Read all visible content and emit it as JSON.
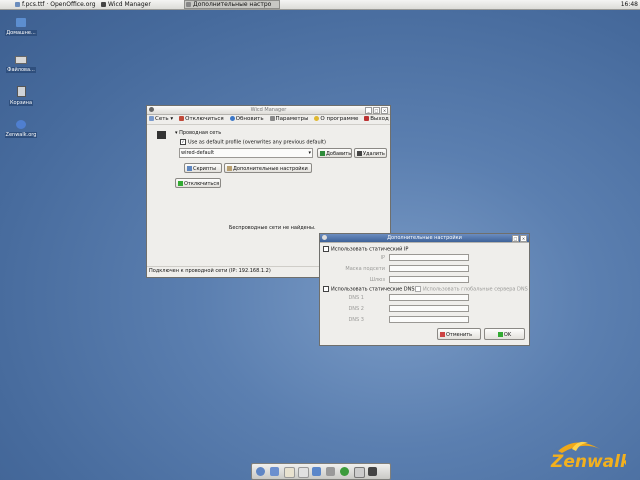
{
  "taskbar": {
    "tasks": [
      {
        "label": "f.pcs.ttf · OpenOffice.org"
      },
      {
        "label": "Wicd Manager"
      },
      {
        "label": "Дополнительные настро"
      }
    ],
    "clock": "16:48"
  },
  "desktop": {
    "icons": [
      {
        "label": "Домашне...",
        "icon": "home-folder-icon"
      },
      {
        "label": "Файлова...",
        "icon": "drive-icon"
      },
      {
        "label": "Корзина",
        "icon": "trash-icon"
      },
      {
        "label": "Zenwalk.org",
        "icon": "link-icon"
      }
    ]
  },
  "wicd": {
    "title": "Wicd Manager",
    "toolbar": {
      "network": "Сеть",
      "disconnect": "Отключиться",
      "refresh": "Обновить",
      "preferences": "Параметры",
      "about": "О программе",
      "quit": "Выход"
    },
    "wired_header": "Проводная сеть",
    "default_profile_label": "Use as default profile (overwrites any previous default)",
    "profile_value": "wired-default",
    "add_label": "Добавить",
    "delete_label": "Удалить",
    "scripts_label": "Скрипты",
    "advanced_label": "Дополнительные настройки",
    "disconnect_label": "Отключиться",
    "no_wireless": "Беспроводные сети не найдены.",
    "status": "Подключен к проводной сети (IP: 192.168.1.2)"
  },
  "advanced": {
    "title": "Дополнительные настройки",
    "static_ip_label": "Использовать статический IP",
    "ip_label": "IP",
    "netmask_label": "Маска подсети",
    "gateway_label": "Шлюз",
    "static_dns_label": "Использовать статические DNS",
    "global_dns_label": "Использовать глобальные сервера DNS",
    "dns1_label": "DNS 1",
    "dns2_label": "DNS 2",
    "dns3_label": "DNS 3",
    "cancel_label": "Отменить",
    "ok_label": "OK"
  },
  "brand": {
    "logo": "Zenwalk"
  }
}
